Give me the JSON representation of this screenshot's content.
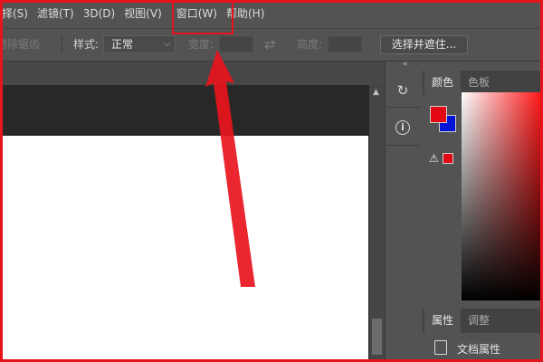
{
  "menubar": {
    "items": [
      "选择(S)",
      "滤镜(T)",
      "3D(D)",
      "视图(V)",
      "窗口(W)",
      "帮助(H)"
    ]
  },
  "options": {
    "antialias_label": "消除锯齿",
    "style_label": "样式:",
    "style_value": "正常",
    "width_label": "宽度:",
    "height_label": "高度:",
    "select_mask_button": "选择并遮住..."
  },
  "panels": {
    "color_tabs": [
      "颜色",
      "色板"
    ],
    "properties_tabs": [
      "属性",
      "调整"
    ],
    "document_properties": "文档属性",
    "foreground_color": "#e30613",
    "background_color": "#0014d4"
  },
  "annotation": {
    "highlight_color": "#e8141d",
    "highlighted_menu": "窗口(W)"
  }
}
